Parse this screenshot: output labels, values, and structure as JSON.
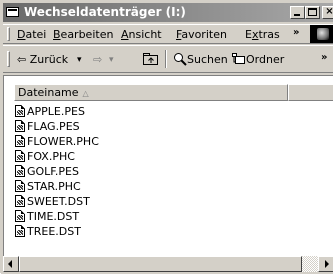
{
  "window": {
    "title": "Wechseldatenträger (I:)",
    "title_icon": "drive-icon"
  },
  "menu": {
    "items": [
      {
        "key": "D",
        "rest": "atei"
      },
      {
        "key": "B",
        "rest": "earbeiten"
      },
      {
        "key": "A",
        "rest": "nsicht"
      },
      {
        "key": "F",
        "rest": "avoriten"
      },
      {
        "key": "x",
        "pre": "E",
        "rest": "tras"
      }
    ],
    "overflow": "»"
  },
  "toolbar": {
    "back_label": "⇦ Zurück",
    "back_dropdown": "▾",
    "forward_label": "⇨",
    "forward_dropdown": "▾",
    "search_label": "Suchen",
    "folders_label": "Ordner",
    "overflow": "»"
  },
  "list": {
    "column_name": "Dateiname",
    "sort_indicator": "△",
    "files": [
      "APPLE.PES",
      "FLAG.PES",
      "FLOWER.PHC",
      "FOX.PHC",
      "GOLF.PES",
      "STAR.PHC",
      "SWEET.DST",
      "TIME.DST",
      "TREE.DST"
    ]
  }
}
